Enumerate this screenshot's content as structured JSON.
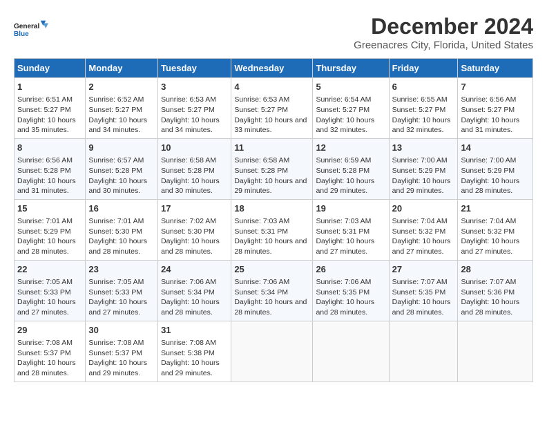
{
  "logo": {
    "line1": "General",
    "line2": "Blue"
  },
  "title": "December 2024",
  "subtitle": "Greenacres City, Florida, United States",
  "headers": [
    "Sunday",
    "Monday",
    "Tuesday",
    "Wednesday",
    "Thursday",
    "Friday",
    "Saturday"
  ],
  "weeks": [
    [
      {
        "day": "1",
        "sunrise": "6:51 AM",
        "sunset": "5:27 PM",
        "daylight": "10 hours and 35 minutes."
      },
      {
        "day": "2",
        "sunrise": "6:52 AM",
        "sunset": "5:27 PM",
        "daylight": "10 hours and 34 minutes."
      },
      {
        "day": "3",
        "sunrise": "6:53 AM",
        "sunset": "5:27 PM",
        "daylight": "10 hours and 34 minutes."
      },
      {
        "day": "4",
        "sunrise": "6:53 AM",
        "sunset": "5:27 PM",
        "daylight": "10 hours and 33 minutes."
      },
      {
        "day": "5",
        "sunrise": "6:54 AM",
        "sunset": "5:27 PM",
        "daylight": "10 hours and 32 minutes."
      },
      {
        "day": "6",
        "sunrise": "6:55 AM",
        "sunset": "5:27 PM",
        "daylight": "10 hours and 32 minutes."
      },
      {
        "day": "7",
        "sunrise": "6:56 AM",
        "sunset": "5:27 PM",
        "daylight": "10 hours and 31 minutes."
      }
    ],
    [
      {
        "day": "8",
        "sunrise": "6:56 AM",
        "sunset": "5:28 PM",
        "daylight": "10 hours and 31 minutes."
      },
      {
        "day": "9",
        "sunrise": "6:57 AM",
        "sunset": "5:28 PM",
        "daylight": "10 hours and 30 minutes."
      },
      {
        "day": "10",
        "sunrise": "6:58 AM",
        "sunset": "5:28 PM",
        "daylight": "10 hours and 30 minutes."
      },
      {
        "day": "11",
        "sunrise": "6:58 AM",
        "sunset": "5:28 PM",
        "daylight": "10 hours and 29 minutes."
      },
      {
        "day": "12",
        "sunrise": "6:59 AM",
        "sunset": "5:28 PM",
        "daylight": "10 hours and 29 minutes."
      },
      {
        "day": "13",
        "sunrise": "7:00 AM",
        "sunset": "5:29 PM",
        "daylight": "10 hours and 29 minutes."
      },
      {
        "day": "14",
        "sunrise": "7:00 AM",
        "sunset": "5:29 PM",
        "daylight": "10 hours and 28 minutes."
      }
    ],
    [
      {
        "day": "15",
        "sunrise": "7:01 AM",
        "sunset": "5:29 PM",
        "daylight": "10 hours and 28 minutes."
      },
      {
        "day": "16",
        "sunrise": "7:01 AM",
        "sunset": "5:30 PM",
        "daylight": "10 hours and 28 minutes."
      },
      {
        "day": "17",
        "sunrise": "7:02 AM",
        "sunset": "5:30 PM",
        "daylight": "10 hours and 28 minutes."
      },
      {
        "day": "18",
        "sunrise": "7:03 AM",
        "sunset": "5:31 PM",
        "daylight": "10 hours and 28 minutes."
      },
      {
        "day": "19",
        "sunrise": "7:03 AM",
        "sunset": "5:31 PM",
        "daylight": "10 hours and 27 minutes."
      },
      {
        "day": "20",
        "sunrise": "7:04 AM",
        "sunset": "5:32 PM",
        "daylight": "10 hours and 27 minutes."
      },
      {
        "day": "21",
        "sunrise": "7:04 AM",
        "sunset": "5:32 PM",
        "daylight": "10 hours and 27 minutes."
      }
    ],
    [
      {
        "day": "22",
        "sunrise": "7:05 AM",
        "sunset": "5:33 PM",
        "daylight": "10 hours and 27 minutes."
      },
      {
        "day": "23",
        "sunrise": "7:05 AM",
        "sunset": "5:33 PM",
        "daylight": "10 hours and 27 minutes."
      },
      {
        "day": "24",
        "sunrise": "7:06 AM",
        "sunset": "5:34 PM",
        "daylight": "10 hours and 28 minutes."
      },
      {
        "day": "25",
        "sunrise": "7:06 AM",
        "sunset": "5:34 PM",
        "daylight": "10 hours and 28 minutes."
      },
      {
        "day": "26",
        "sunrise": "7:06 AM",
        "sunset": "5:35 PM",
        "daylight": "10 hours and 28 minutes."
      },
      {
        "day": "27",
        "sunrise": "7:07 AM",
        "sunset": "5:35 PM",
        "daylight": "10 hours and 28 minutes."
      },
      {
        "day": "28",
        "sunrise": "7:07 AM",
        "sunset": "5:36 PM",
        "daylight": "10 hours and 28 minutes."
      }
    ],
    [
      {
        "day": "29",
        "sunrise": "7:08 AM",
        "sunset": "5:37 PM",
        "daylight": "10 hours and 28 minutes."
      },
      {
        "day": "30",
        "sunrise": "7:08 AM",
        "sunset": "5:37 PM",
        "daylight": "10 hours and 29 minutes."
      },
      {
        "day": "31",
        "sunrise": "7:08 AM",
        "sunset": "5:38 PM",
        "daylight": "10 hours and 29 minutes."
      },
      null,
      null,
      null,
      null
    ]
  ],
  "labels": {
    "sunrise": "Sunrise:",
    "sunset": "Sunset:",
    "daylight": "Daylight:"
  }
}
